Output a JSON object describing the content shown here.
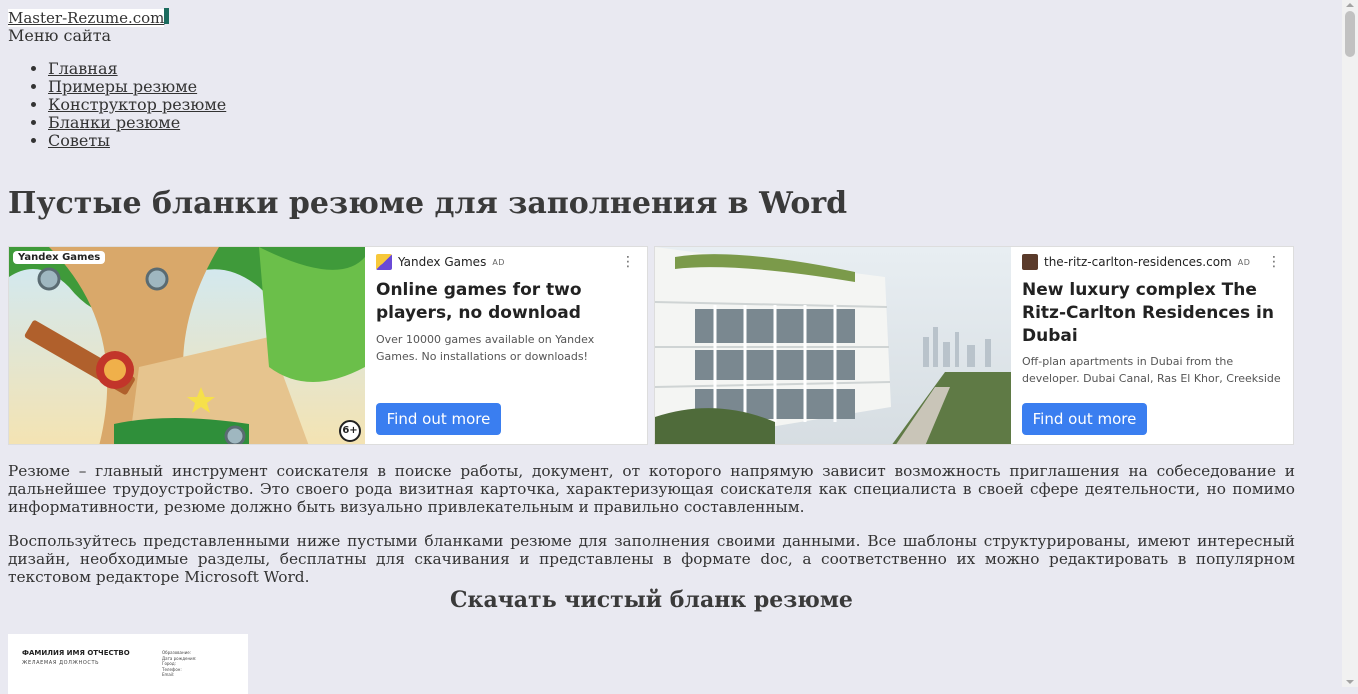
{
  "site": {
    "logo_text": "Master-Rezume.com"
  },
  "menu": {
    "title": "Меню сайта",
    "items": [
      "Главная",
      "Примеры резюме",
      "Конструктор резюме",
      "Бланки резюме",
      "Советы"
    ]
  },
  "page_title": "Пустые бланки резюме для заполнения в Word",
  "ads": [
    {
      "image_badge": "Yandex Games",
      "age_rating": "6+",
      "source": "Yandex Games",
      "ad_tag": "AD",
      "headline": "Online games for two players, no download",
      "description": "Over 10000 games available on Yandex Games. No installations or downloads!",
      "button": "Find out more"
    },
    {
      "source": "the-ritz-carlton-residences.com",
      "ad_tag": "AD",
      "headline": "New luxury complex The Ritz-Carlton Residences in Dubai",
      "description": "Off-plan apartments in Dubai from the developer. Dubai Canal, Ras El Khor, Creekside",
      "button": "Find out more"
    }
  ],
  "paragraphs": [
    "Резюме – главный инструмент соискателя в поиске работы, документ, от которого напрямую зависит возможность приглашения на собеседование и дальнейшее трудоустройство. Это своего рода визитная карточка, характеризующая соискателя как специалиста в своей сфере деятельности, но помимо информативности, резюме должно быть визуально привлекательным и правильно составленным.",
    "Воспользуйтесь представленными ниже пустыми бланками резюме для заполнения своими данными. Все шаблоны структурированы, имеют интересный дизайн, необходимые разделы, бесплатны для скачивания и представлены в формате doc, а соответственно их можно редактировать в популярном текстовом редакторе Microsoft Word."
  ],
  "section_heading": "Скачать чистый бланк резюме",
  "preview": {
    "name": "ФАМИЛИЯ ИМЯ ОТЧЕСТВО",
    "position": "ЖЕЛАЕМАЯ ДОЛЖНОСТЬ",
    "info": [
      "Образование:",
      "Дата рождения:",
      "Город:",
      "Телефон:",
      "Email:"
    ]
  }
}
